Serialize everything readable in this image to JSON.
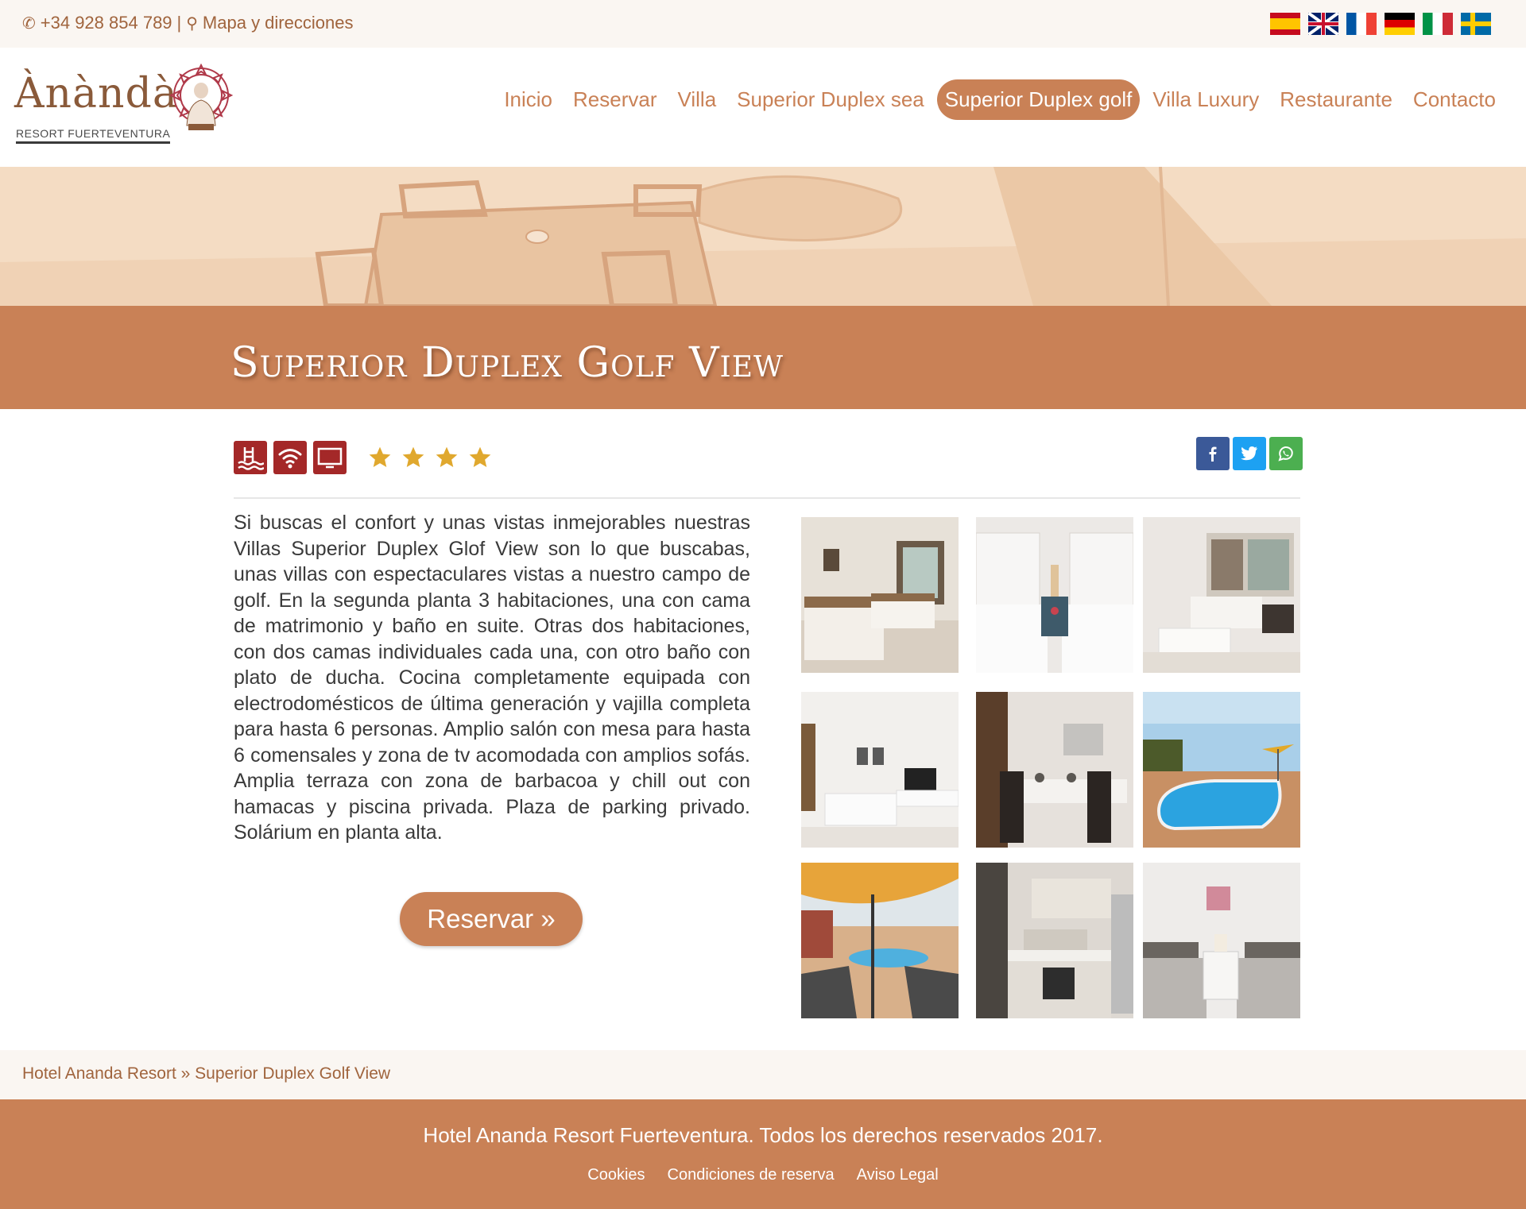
{
  "topbar": {
    "phone": "+34 928 854 789",
    "separator": "|",
    "map_link": "Mapa y direcciones",
    "languages": [
      "es",
      "en",
      "fr",
      "de",
      "it",
      "sv"
    ]
  },
  "logo": {
    "wordmark": "Ànàndà",
    "subtitle": "RESORT FUERTEVENTURA"
  },
  "nav": {
    "items": [
      {
        "label": "Inicio"
      },
      {
        "label": "Reservar"
      },
      {
        "label": "Villa"
      },
      {
        "label": "Superior Duplex sea"
      },
      {
        "label": "Superior Duplex golf"
      },
      {
        "label": "Villa Luxury"
      },
      {
        "label": "Restaurante"
      },
      {
        "label": "Contacto"
      }
    ],
    "active_index": 4
  },
  "page": {
    "title": "Superior Duplex Golf View",
    "features": [
      "pool-icon",
      "wifi-icon",
      "tv-icon"
    ],
    "stars": 4,
    "share": [
      "facebook",
      "twitter",
      "whatsapp"
    ],
    "description": "Si buscas el confort y unas vistas inmejorables nuestras Villas Superior Duplex Glof View son lo que buscabas, unas villas con espectaculares vistas a nuestro campo de golf. En la segunda planta 3 habitaciones, una con cama de matrimonio y baño en suite. Otras dos habitaciones, con dos camas individuales cada una, con otro baño con plato de ducha. Cocina completamente equipada con electrodomésticos de última generación y vajilla completa para hasta 6 personas. Amplio salón con mesa para hasta 6 comensales y zona de tv acomodada con amplios sofás. Amplia terraza con zona de barbacoa y chill out con hamacas y piscina privada. Plaza de parking privado. Solárium en planta alta.",
    "reserve_button": "Reservar »"
  },
  "gallery": {
    "photos": [
      "bedroom-twin",
      "bedroom-headboards",
      "living-room",
      "lounge-tv",
      "dining-room",
      "pool",
      "terrace-umbrella",
      "kitchen",
      "bedroom-nightstand"
    ]
  },
  "breadcrumb": {
    "home": "Hotel Ananda Resort",
    "sep": "»",
    "current": "Superior Duplex Golf View"
  },
  "footer": {
    "copyright": "Hotel Ananda Resort Fuerteventura. Todos los derechos reservados 2017.",
    "links": [
      "Cookies",
      "Condiciones de reserva",
      "Aviso Legal"
    ]
  },
  "colors": {
    "brand": "#c98156",
    "feature_icon_bg": "#a42828",
    "star": "#e0a82e",
    "topbar_bg": "#faf6f2"
  }
}
